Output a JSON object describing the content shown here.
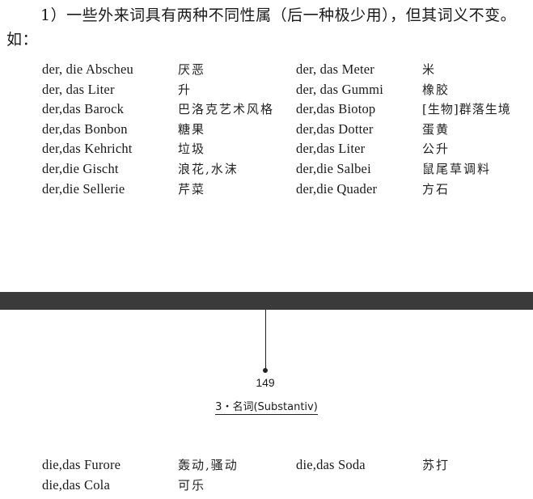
{
  "intro": "1）一些外来词具有两种不同性属（后一种极少用），但其词义不变。如：",
  "top_rows": [
    {
      "w1": "der, die Abscheu",
      "m1": "厌恶",
      "w2": "der, das Meter",
      "m2": "米"
    },
    {
      "w1": "der, das Liter",
      "m1": "升",
      "w2": "der, das Gummi",
      "m2": "橡胶"
    },
    {
      "w1": "der,das Barock",
      "m1": "巴洛克艺术风格",
      "w2": "der,das Biotop",
      "m2": "[生物]群落生境"
    },
    {
      "w1": "der,das Bonbon",
      "m1": "糖果",
      "w2": "der,das Dotter",
      "m2": "蛋黄"
    },
    {
      "w1": "der,das Kehricht",
      "m1": "垃圾",
      "w2": "der,das Liter",
      "m2": "公升"
    },
    {
      "w1": "der,die Gischt",
      "m1": "浪花,水沫",
      "w2": "der,die Salbei",
      "m2": "鼠尾草调料"
    },
    {
      "w1": "der,die Sellerie",
      "m1": "芹菜",
      "w2": "der,die Quader",
      "m2": "方石"
    }
  ],
  "page_number": "149",
  "chapter_label": "3・名词(Substantiv)",
  "bottom_rows": [
    {
      "w1": "die,das Furore",
      "m1": "轰动,骚动",
      "w2": "die,das Soda",
      "m2": "苏打"
    },
    {
      "w1": "die,das Cola",
      "m1": "可乐",
      "w2": "",
      "m2": ""
    }
  ]
}
